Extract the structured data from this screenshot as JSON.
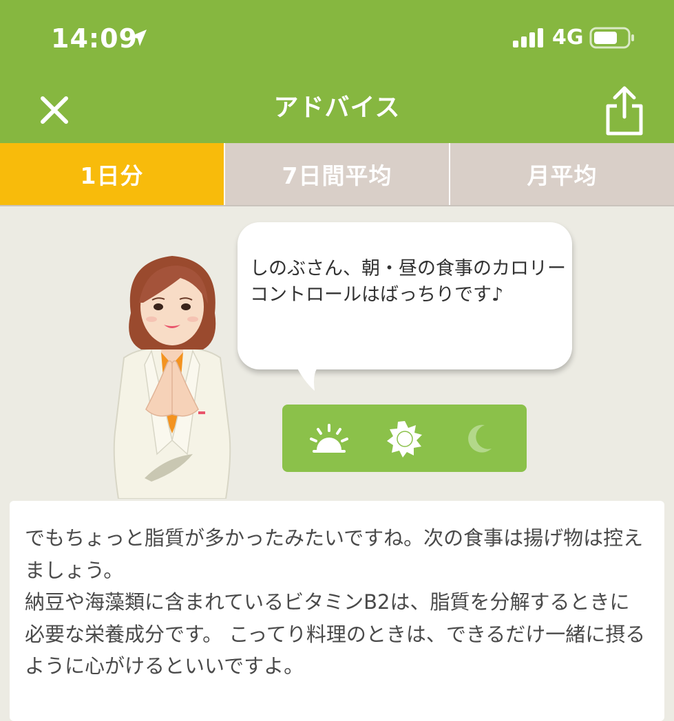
{
  "status_bar": {
    "time": "14:09",
    "network": "4G",
    "icons": [
      "location-arrow-icon",
      "signal-bars-icon",
      "battery-icon"
    ]
  },
  "nav": {
    "title": "アドバイス",
    "close_icon": "close-icon",
    "share_icon": "share-icon"
  },
  "tabs": [
    {
      "label": "1日分",
      "active": true
    },
    {
      "label": "7日間平均",
      "active": false
    },
    {
      "label": "月平均",
      "active": false
    }
  ],
  "speech": {
    "text": "しのぶさん、朝・昼の食事のカロリーコントロールはばっちりです♪"
  },
  "meals": {
    "icons": [
      "sunrise-icon",
      "sun-icon",
      "moon-icon"
    ],
    "evaluated": [
      true,
      true,
      false
    ]
  },
  "advice": {
    "text": "でもちょっと脂質が多かったみたいですね。次の食事は揚げ物は控えましょう。\n納豆や海藻類に含まれているビタミンB2は、脂質を分解するときに必要な栄養成分です。 こってり料理のときは、できるだけ一緒に摂るように心がけるといいですよ。"
  },
  "colors": {
    "header_green": "#86b740",
    "tab_active": "#f8bb0b",
    "tab_inactive": "#d9cfc8",
    "background": "#ecebe3",
    "meal_panel": "#8bc14a"
  }
}
